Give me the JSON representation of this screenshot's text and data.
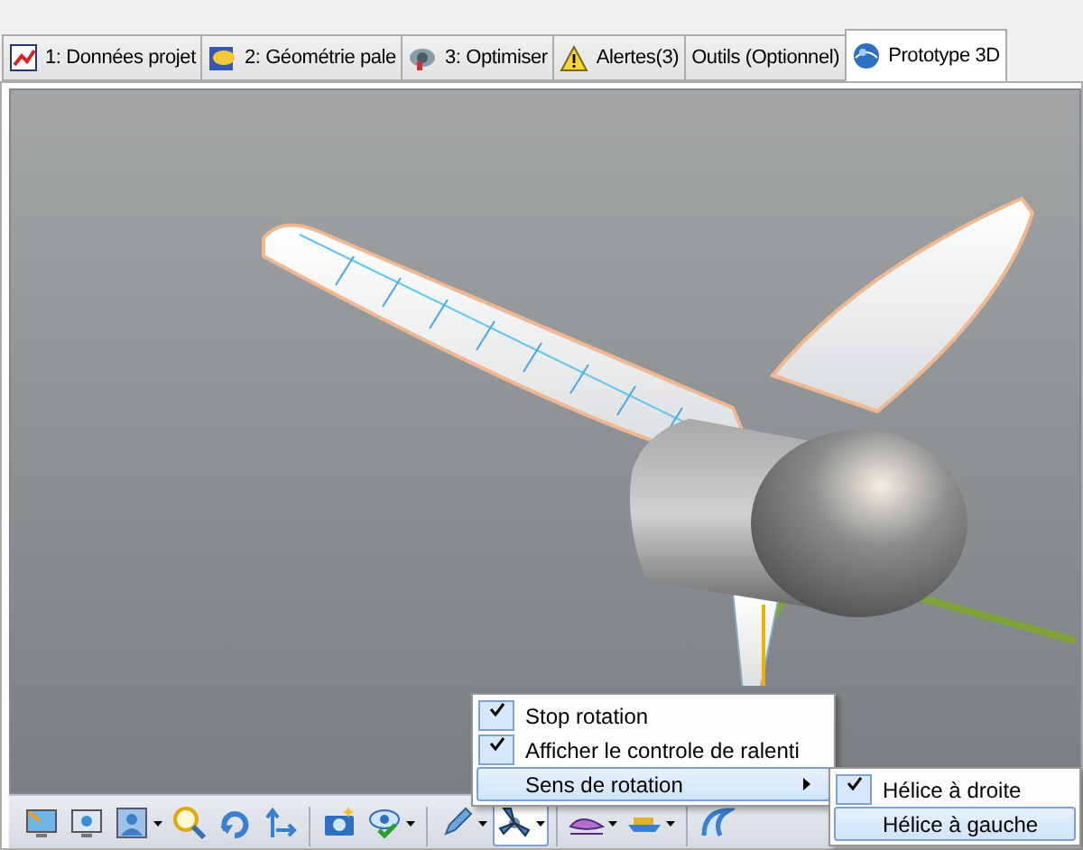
{
  "tabs": [
    {
      "label": "1: Données projet",
      "kind": "chart",
      "selected": false
    },
    {
      "label": "2: Géométrie pale",
      "kind": "blade",
      "selected": false
    },
    {
      "label": "3: Optimiser",
      "kind": "optimize",
      "selected": false
    },
    {
      "label": "Alertes(3)",
      "kind": "warning",
      "selected": false
    },
    {
      "label": "Outils (Optionnel)",
      "kind": "plain",
      "selected": false
    },
    {
      "label": "Prototype 3D",
      "kind": "globe",
      "selected": true
    }
  ],
  "toolbar": {
    "groups": [
      [
        {
          "kind": "screen",
          "dropdown": false,
          "pressed": false
        },
        {
          "kind": "gear",
          "dropdown": false,
          "pressed": false
        },
        {
          "kind": "person",
          "dropdown": true,
          "pressed": false
        },
        {
          "kind": "zoom",
          "dropdown": false,
          "pressed": false
        },
        {
          "kind": "rotate",
          "dropdown": false,
          "pressed": false
        },
        {
          "kind": "pan",
          "dropdown": false,
          "pressed": false
        }
      ],
      [
        {
          "kind": "camera",
          "dropdown": false,
          "pressed": false
        },
        {
          "kind": "eye",
          "dropdown": true,
          "pressed": false
        }
      ],
      [
        {
          "kind": "pencil",
          "dropdown": true,
          "pressed": false
        },
        {
          "kind": "propeller",
          "dropdown": true,
          "pressed": true
        }
      ],
      [
        {
          "kind": "profile",
          "dropdown": true,
          "pressed": false
        },
        {
          "kind": "boat",
          "dropdown": true,
          "pressed": false
        }
      ],
      [
        {
          "kind": "spiral",
          "dropdown": false,
          "pressed": false
        }
      ]
    ]
  },
  "menu": {
    "items": [
      {
        "label": "Stop rotation",
        "checked": true,
        "selected": false,
        "submenu": false
      },
      {
        "label": "Afficher le controle de ralenti",
        "checked": true,
        "selected": false,
        "submenu": false
      },
      {
        "label": "Sens de rotation",
        "checked": false,
        "selected": true,
        "submenu": true
      }
    ]
  },
  "submenu": {
    "items": [
      {
        "label": "Hélice à droite",
        "checked": true,
        "selected": false
      },
      {
        "label": "Hélice à gauche",
        "checked": false,
        "selected": true
      }
    ]
  }
}
